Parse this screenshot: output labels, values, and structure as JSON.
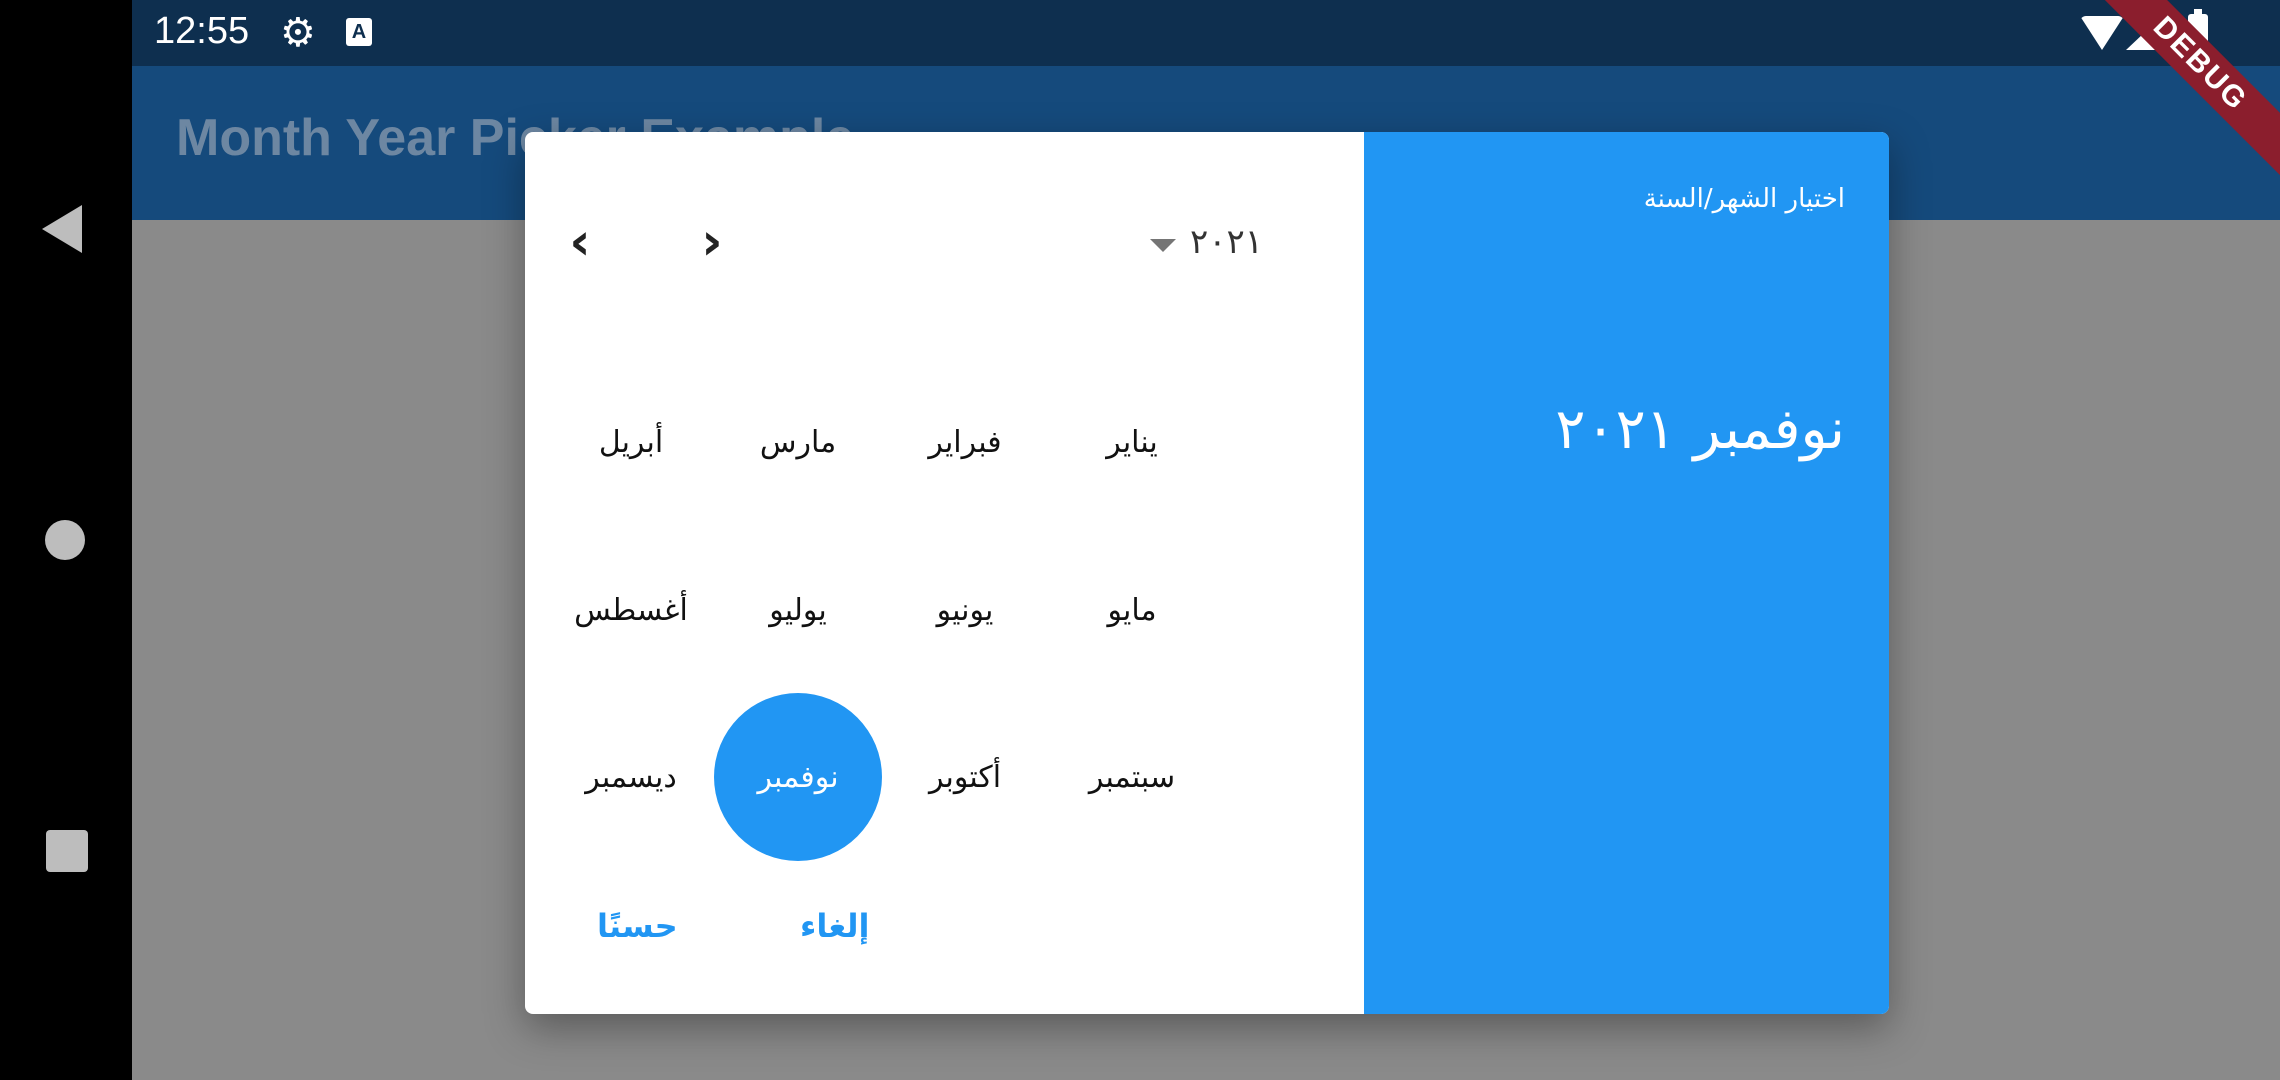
{
  "status_bar": {
    "time": "12:55",
    "settings_icon": "gear-icon",
    "accessibility_icon": "A"
  },
  "app_bar": {
    "title": "Month Year Picker Example"
  },
  "debug_banner": "DEBUG",
  "dialog": {
    "header": {
      "caption": "اختيار الشهر/السنة",
      "selected": "نوفمبر ٢٠٢١"
    },
    "year": "٢٠٢١",
    "nav": {
      "prev": "‹",
      "next": "›"
    },
    "months": [
      "يناير",
      "فبراير",
      "مارس",
      "أبريل",
      "مايو",
      "يونيو",
      "يوليو",
      "أغسطس",
      "سبتمبر",
      "أكتوبر",
      "نوفمبر",
      "ديسمبر"
    ],
    "selected_month": "نوفمبر",
    "buttons": {
      "cancel": "إلغاء",
      "ok": "حسنًا"
    }
  },
  "colors": {
    "accent": "#2196f3",
    "app_bar": "#154a7c",
    "status_bar": "#0e2f4f",
    "scrim": "#8a8a8a"
  }
}
